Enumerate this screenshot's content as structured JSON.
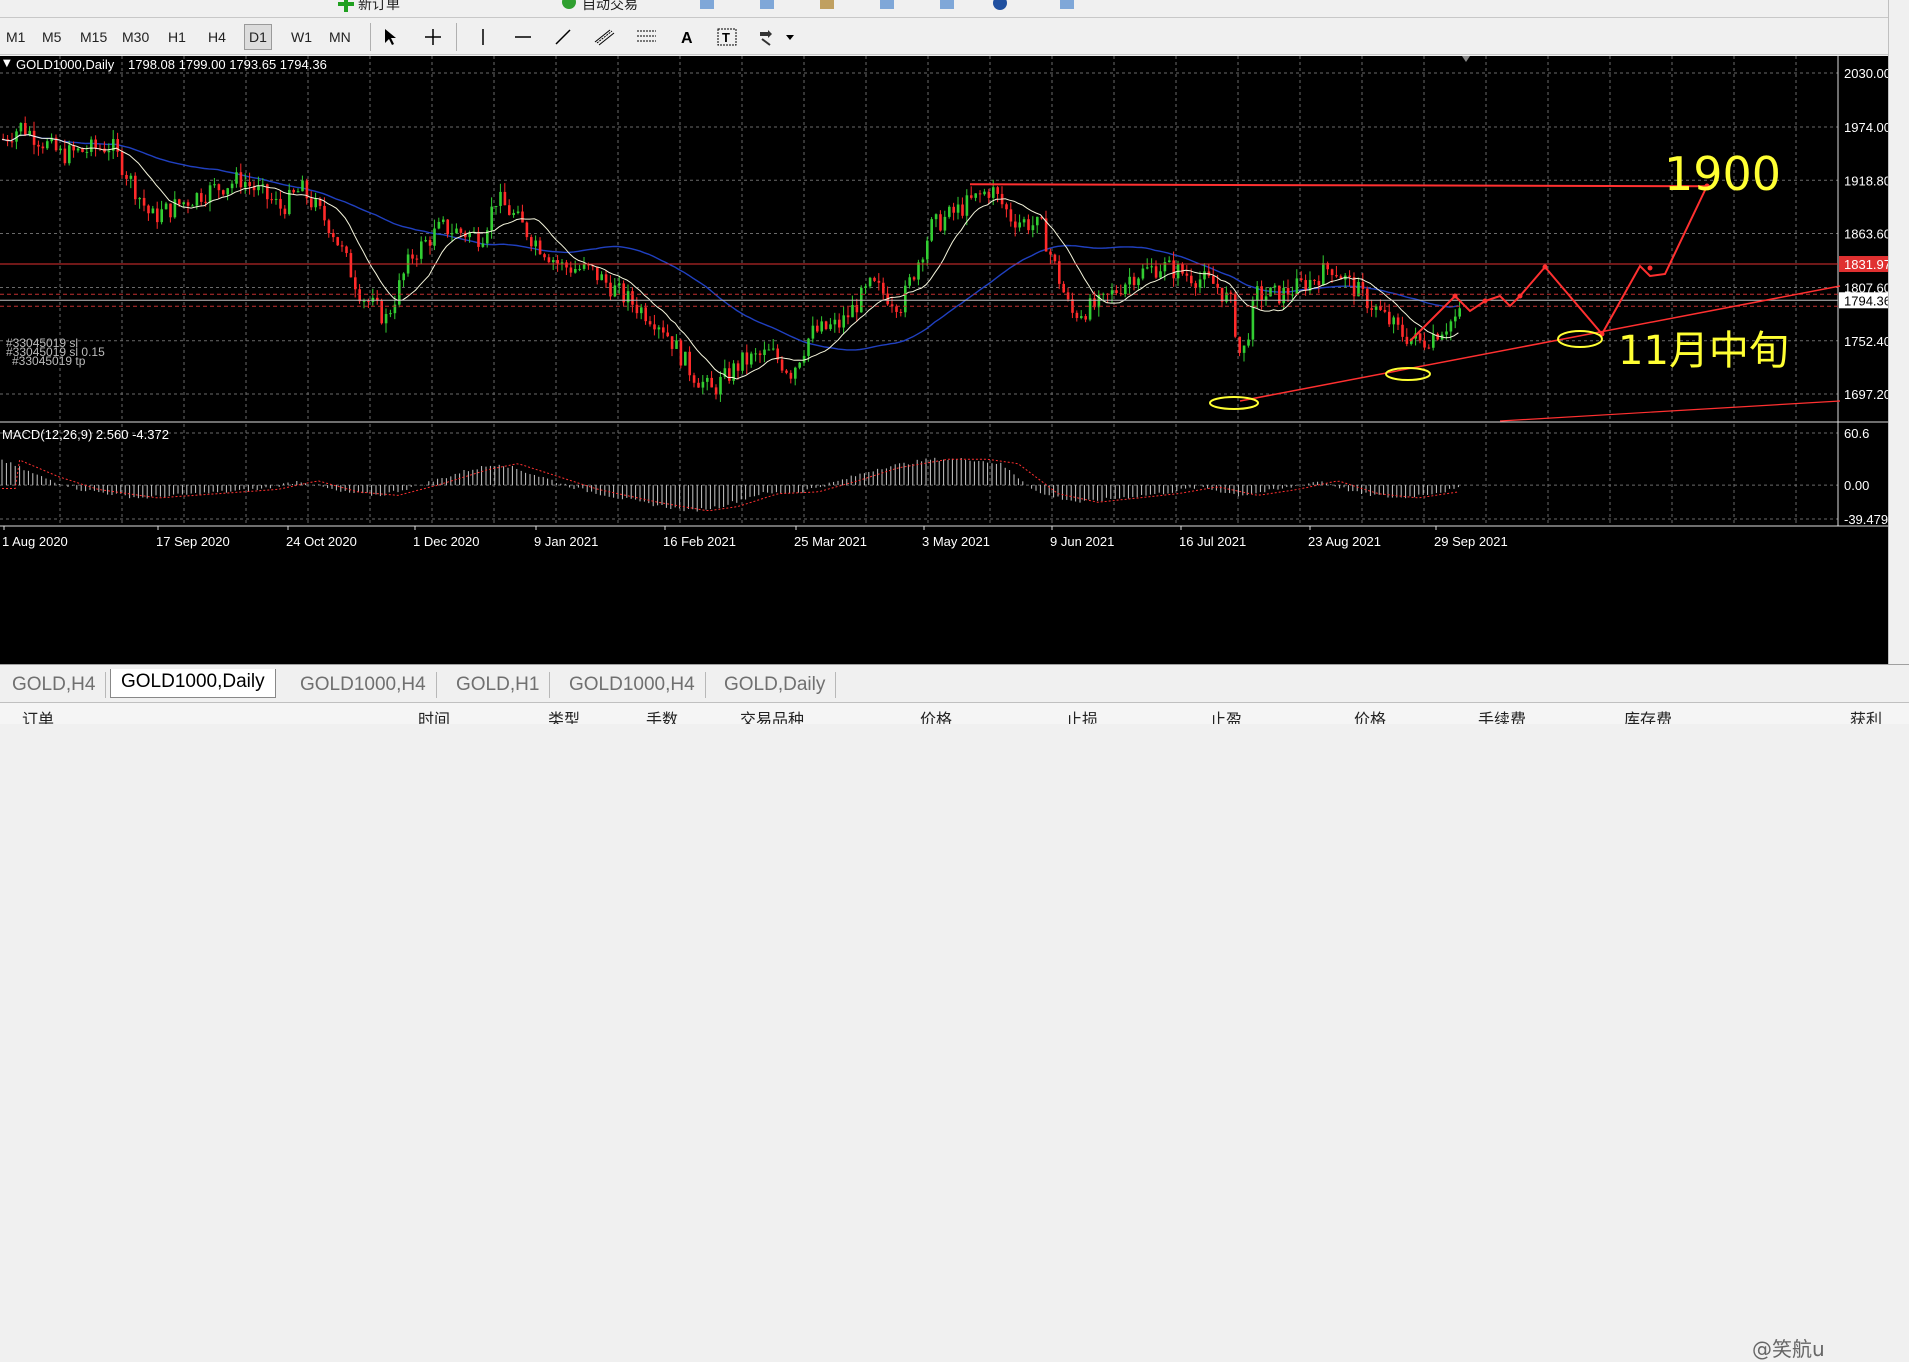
{
  "window": {
    "top_toolbar_labels": [
      "新订单",
      "自动交易"
    ]
  },
  "timeframes": [
    "M1",
    "M5",
    "M15",
    "M30",
    "H1",
    "H4",
    "D1",
    "W1",
    "MN"
  ],
  "active_timeframe": "D1",
  "chart": {
    "header_symbol": "GOLD1000,Daily",
    "header_ohlc": "1798.08 1799.00 1793.65 1794.36",
    "order_labels": [
      "#33045019 sl",
      "#33045019 tp",
      "#33045019 sl 0.15"
    ],
    "price_axis": [
      "2030.00",
      "1974.00",
      "1918.80",
      "1863.60",
      "1807.60",
      "1752.40",
      "1697.20"
    ],
    "resistance_label": "1831.97",
    "current_price_label": "1794.36",
    "date_axis": [
      "1 Aug 2020",
      "17 Sep 2020",
      "24 Oct 2020",
      "1 Dec 2020",
      "9 Jan 2021",
      "16 Feb 2021",
      "25 Mar 2021",
      "3 May 2021",
      "9 Jun 2021",
      "16 Jul 2021",
      "23 Aug 2021",
      "29 Sep 2021"
    ],
    "annotation_target": "1900",
    "annotation_time": "11月中旬"
  },
  "macd": {
    "label": "MACD(12,26,9) 2.560 -4.372",
    "axis": [
      "60.6",
      "0.00",
      "-39.479"
    ]
  },
  "colors": {
    "background": "#000000",
    "bull_candle": "#32cd32",
    "bear_candle": "#ff2a2a",
    "ma_fast": "#f5f5dc",
    "ma_slow": "#2040c0",
    "annotation_red": "#ff3030",
    "annotation_yellow": "#ffff33"
  },
  "tabs": [
    "GOLD,H4",
    "GOLD1000,Daily",
    "GOLD1000,H4",
    "GOLD,H1",
    "GOLD1000,H4",
    "GOLD,Daily"
  ],
  "active_tab": "GOLD1000,Daily",
  "terminal_headers": [
    "订单",
    "时间",
    "类型",
    "手数",
    "交易品种",
    "价格",
    "止损",
    "止盈",
    "价格",
    "手续费",
    "库存费",
    "获利"
  ],
  "watermark": "@笑航u"
}
